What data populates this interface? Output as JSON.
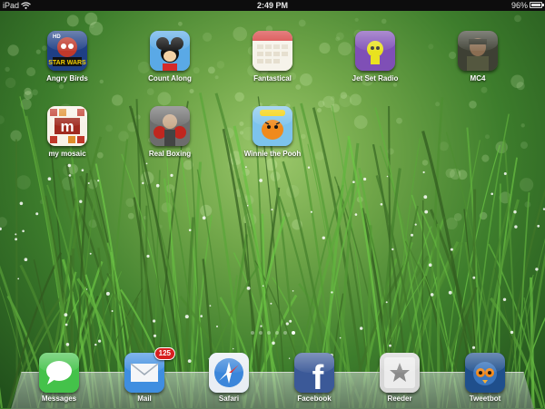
{
  "status_bar": {
    "device": "iPad",
    "time": "2:49 PM",
    "battery_percent": "96%",
    "battery_level": 0.96
  },
  "home_apps": [
    {
      "label": "Angry Birds",
      "icon": "angry-birds-star-wars-icon",
      "color": "#2a56a8"
    },
    {
      "label": "Count Along",
      "icon": "mickey-mouse-icon",
      "color": "#5aa9e6"
    },
    {
      "label": "Fantastical",
      "icon": "calendar-icon",
      "color": "#f4f1e8"
    },
    {
      "label": "Jet Set Radio",
      "icon": "jet-set-radio-icon",
      "color": "#7f4fb6"
    },
    {
      "label": "MC4",
      "icon": "soldier-icon",
      "color": "#5a5a48"
    },
    {
      "label": "my mosaic",
      "icon": "mosaic-m-icon",
      "color": "#c0392b"
    },
    {
      "label": "Real Boxing",
      "icon": "boxer-icon",
      "color": "#8a8a8a"
    },
    {
      "label": "Winnie the Pooh",
      "icon": "tigger-icon",
      "color": "#6cb6e8"
    }
  ],
  "page_dots": {
    "count": 6,
    "active_index": 5
  },
  "dock_apps": [
    {
      "label": "Messages",
      "icon": "speech-bubble-icon",
      "color": "#3fbf3f"
    },
    {
      "label": "Mail",
      "icon": "envelope-icon",
      "color": "#3f86d8",
      "badge": "125"
    },
    {
      "label": "Safari",
      "icon": "compass-icon",
      "color": "#3b7fd1"
    },
    {
      "label": "Facebook",
      "icon": "facebook-f-icon",
      "color": "#3b5998"
    },
    {
      "label": "Reeder",
      "icon": "star-icon",
      "color": "#d0d0d0"
    },
    {
      "label": "Tweetbot",
      "icon": "bird-robot-icon",
      "color": "#2c5f9e"
    }
  ]
}
